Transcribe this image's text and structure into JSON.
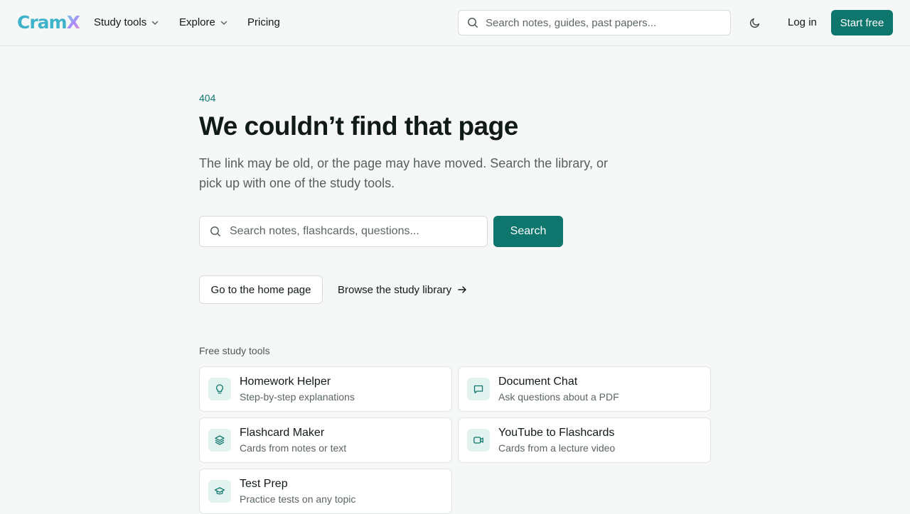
{
  "header": {
    "logo_part1": "Cram",
    "logo_part2": "X",
    "nav": [
      {
        "label": "Study tools",
        "has_dropdown": true
      },
      {
        "label": "Explore",
        "has_dropdown": true
      },
      {
        "label": "Pricing",
        "has_dropdown": false
      }
    ],
    "search": {
      "placeholder": "Search notes, guides, past papers...",
      "value": ""
    },
    "theme_icon": "moon-icon",
    "login_label": "Log in",
    "start_label": "Start free"
  },
  "error": {
    "code": "404",
    "title": "We couldn’t find that page",
    "description": "The link may be old, or the page may have moved. Search the library, or pick up with one of the study tools."
  },
  "search": {
    "placeholder": "Search notes, flashcards, questions...",
    "value": "",
    "button_label": "Search"
  },
  "actions": {
    "home_label": "Go to the home page",
    "browse_label": "Browse the study library"
  },
  "tools": {
    "section_label": "Free study tools",
    "items": [
      {
        "title": "Homework Helper",
        "subtitle": "Step-by-step explanations",
        "icon": "lightbulb-icon"
      },
      {
        "title": "Document Chat",
        "subtitle": "Ask questions about a PDF",
        "icon": "chat-icon"
      },
      {
        "title": "Flashcard Maker",
        "subtitle": "Cards from notes or text",
        "icon": "layers-icon"
      },
      {
        "title": "YouTube to Flashcards",
        "subtitle": "Cards from a lecture video",
        "icon": "video-icon"
      },
      {
        "title": "Test Prep",
        "subtitle": "Practice tests on any topic",
        "icon": "graduation-cap-icon"
      }
    ]
  },
  "colors": {
    "accent": "#0f766e",
    "icon_bg": "#e2f3ef",
    "page_bg": "#f6f7f7"
  }
}
